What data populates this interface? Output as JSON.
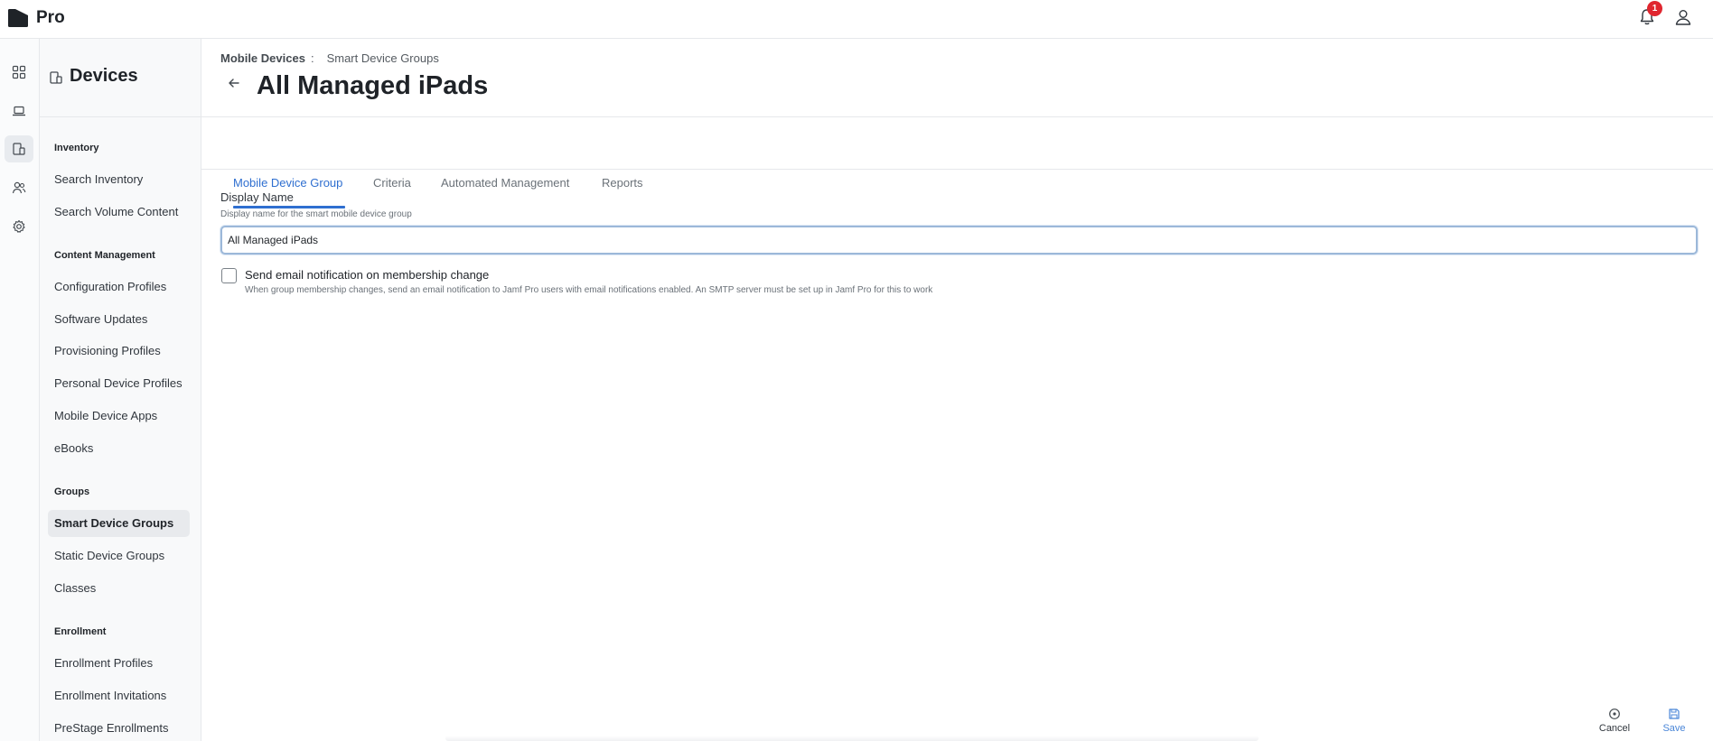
{
  "app": {
    "name": "Pro",
    "notification_count": "1"
  },
  "nav": {
    "title": "Devices",
    "sections": [
      {
        "label": "Inventory"
      },
      {
        "label": "Content Management"
      },
      {
        "label": "Groups"
      },
      {
        "label": "Enrollment"
      }
    ],
    "items": [
      {
        "label": "Search Inventory"
      },
      {
        "label": "Search Volume Content"
      },
      {
        "label": "Configuration Profiles"
      },
      {
        "label": "Software Updates"
      },
      {
        "label": "Provisioning Profiles"
      },
      {
        "label": "Personal Device Profiles"
      },
      {
        "label": "Mobile Device Apps"
      },
      {
        "label": "eBooks"
      },
      {
        "label": "Smart Device Groups",
        "active": true
      },
      {
        "label": "Static Device Groups"
      },
      {
        "label": "Classes"
      },
      {
        "label": "Enrollment Profiles"
      },
      {
        "label": "Enrollment Invitations"
      },
      {
        "label": "PreStage Enrollments"
      }
    ]
  },
  "breadcrumb": {
    "parent": "Mobile Devices",
    "separator": ":",
    "current": "Smart Device Groups"
  },
  "page": {
    "title": "All Managed iPads"
  },
  "tabs": [
    {
      "label": "Mobile Device Group",
      "active": true
    },
    {
      "label": "Criteria"
    },
    {
      "label": "Automated Management"
    },
    {
      "label": "Reports"
    }
  ],
  "form": {
    "display_name": {
      "label": "Display Name",
      "help": "Display name for the smart mobile device group",
      "value": "All Managed iPads"
    },
    "email_notification": {
      "label": "Send email notification on membership change",
      "help": "When group membership changes, send an email notification to Jamf Pro users with email notifications enabled. An SMTP server must be set up in Jamf Pro for this to work",
      "checked": false
    }
  },
  "actions": {
    "cancel": "Cancel",
    "save": "Save"
  },
  "colors": {
    "accent": "#2f6fd0",
    "badge": "#e0262f"
  }
}
